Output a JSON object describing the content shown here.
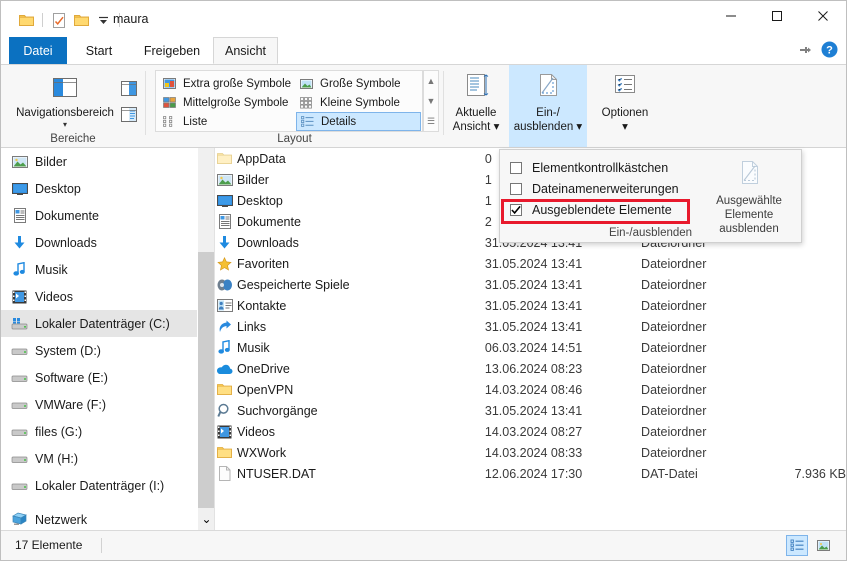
{
  "window": {
    "title": "maura",
    "quick_access": [
      "folder-icon",
      "properties-icon",
      "new-folder-icon",
      "chevron-down-icon"
    ],
    "controls": {
      "minimize": "minimize-icon",
      "maximize": "maximize-icon",
      "close": "close-icon"
    },
    "help": {
      "pin": "pin-ribbon-icon",
      "help": "help-icon"
    }
  },
  "tabs": [
    {
      "label": "Datei",
      "name": "tab-datei"
    },
    {
      "label": "Start",
      "name": "tab-start"
    },
    {
      "label": "Freigeben",
      "name": "tab-freigeben"
    },
    {
      "label": "Ansicht",
      "name": "tab-ansicht"
    }
  ],
  "ribbon": {
    "groups": [
      {
        "label": "Bereiche"
      },
      {
        "label": "Layout"
      }
    ],
    "nav_pane": {
      "label": "Navigationsbereich",
      "caret": "▾"
    },
    "pane_buttons": [
      "preview-pane-icon",
      "details-pane-icon"
    ],
    "layout_items": [
      {
        "label": "Extra große Symbole",
        "icon": "extra-large-icons-icon",
        "selected": false
      },
      {
        "label": "Große Symbole",
        "icon": "large-icons-icon",
        "selected": false
      },
      {
        "label": "Mittelgroße Symbole",
        "icon": "medium-icons-icon",
        "selected": false
      },
      {
        "label": "Kleine Symbole",
        "icon": "small-icons-icon",
        "selected": false
      },
      {
        "label": "Liste",
        "icon": "list-icon",
        "selected": false
      },
      {
        "label": "Details",
        "icon": "details-icon",
        "selected": true
      }
    ],
    "scroll_glyphs": [
      "▲",
      "▼",
      "☰"
    ],
    "buttons": [
      {
        "label_line1": "Aktuelle",
        "label_line2": "Ansicht ▾",
        "icon": "current-view-icon",
        "active": false
      },
      {
        "label_line1": "Ein-/",
        "label_line2": "ausblenden ▾",
        "icon": "show-hide-icon",
        "active": true
      },
      {
        "label_line1": "Optionen",
        "label_line2": "▾",
        "icon": "options-icon",
        "active": false
      }
    ]
  },
  "dropdown": {
    "items": [
      {
        "label": "Elementkontrollkästchen",
        "checked": false
      },
      {
        "label": "Dateinamenerweiterungen",
        "checked": false
      },
      {
        "label": "Ausgeblendete Elemente",
        "checked": true
      }
    ],
    "button": {
      "label_line1": "Ausgewählte",
      "label_line2": "Elemente ausblenden",
      "icon": "hide-selected-icon"
    },
    "group_label": "Ein-/ausblenden",
    "highlight_color": "#e8192c",
    "check_glyph": "✔"
  },
  "nav_tree": {
    "items": [
      {
        "label": "Bilder",
        "icon": "pictures-icon",
        "selected": false
      },
      {
        "label": "Desktop",
        "icon": "desktop-icon",
        "selected": false
      },
      {
        "label": "Dokumente",
        "icon": "documents-icon",
        "selected": false
      },
      {
        "label": "Downloads",
        "icon": "downloads-icon",
        "selected": false
      },
      {
        "label": "Musik",
        "icon": "music-icon",
        "selected": false
      },
      {
        "label": "Videos",
        "icon": "videos-icon",
        "selected": false
      },
      {
        "label": "Lokaler Datenträger (C:)",
        "icon": "drive-icon",
        "selected": true
      },
      {
        "label": "System (D:)",
        "icon": "drive-icon",
        "selected": false
      },
      {
        "label": "Software (E:)",
        "icon": "drive-icon",
        "selected": false
      },
      {
        "label": "VMWare (F:)",
        "icon": "drive-icon",
        "selected": false
      },
      {
        "label": "files (G:)",
        "icon": "drive-icon",
        "selected": false
      },
      {
        "label": "VM (H:)",
        "icon": "drive-icon",
        "selected": false
      },
      {
        "label": "Lokaler Datenträger (I:)",
        "icon": "drive-icon",
        "selected": false
      },
      {
        "label": "Netzwerk",
        "icon": "network-icon",
        "selected": false
      }
    ],
    "scroll_down_glyph": "⌄"
  },
  "file_list": {
    "rows": [
      {
        "name": "AppData",
        "icon": "folder-faded-icon",
        "date": "0",
        "type": "",
        "size": ""
      },
      {
        "name": "Bilder",
        "icon": "pictures-icon",
        "date": "1",
        "type": "",
        "size": ""
      },
      {
        "name": "Desktop",
        "icon": "desktop-icon",
        "date": "1",
        "type": "",
        "size": ""
      },
      {
        "name": "Dokumente",
        "icon": "documents-icon",
        "date": "2",
        "type": "",
        "size": ""
      },
      {
        "name": "Downloads",
        "icon": "downloads-icon",
        "date": "31.05.2024 13:41",
        "type": "Dateiordner",
        "size": ""
      },
      {
        "name": "Favoriten",
        "icon": "favorites-icon",
        "date": "31.05.2024 13:41",
        "type": "Dateiordner",
        "size": ""
      },
      {
        "name": "Gespeicherte Spiele",
        "icon": "saved-games-icon",
        "date": "31.05.2024 13:41",
        "type": "Dateiordner",
        "size": ""
      },
      {
        "name": "Kontakte",
        "icon": "contacts-icon",
        "date": "31.05.2024 13:41",
        "type": "Dateiordner",
        "size": ""
      },
      {
        "name": "Links",
        "icon": "links-icon",
        "date": "31.05.2024 13:41",
        "type": "Dateiordner",
        "size": ""
      },
      {
        "name": "Musik",
        "icon": "music-icon",
        "date": "06.03.2024 14:51",
        "type": "Dateiordner",
        "size": ""
      },
      {
        "name": "OneDrive",
        "icon": "onedrive-icon",
        "date": "13.06.2024 08:23",
        "type": "Dateiordner",
        "size": ""
      },
      {
        "name": "OpenVPN",
        "icon": "folder-icon",
        "date": "14.03.2024 08:46",
        "type": "Dateiordner",
        "size": ""
      },
      {
        "name": "Suchvorgänge",
        "icon": "searches-icon",
        "date": "31.05.2024 13:41",
        "type": "Dateiordner",
        "size": ""
      },
      {
        "name": "Videos",
        "icon": "videos-icon",
        "date": "14.03.2024 08:27",
        "type": "Dateiordner",
        "size": ""
      },
      {
        "name": "WXWork",
        "icon": "folder-icon",
        "date": "14.03.2024 08:33",
        "type": "Dateiordner",
        "size": ""
      },
      {
        "name": "NTUSER.DAT",
        "icon": "file-icon",
        "date": "12.06.2024 17:30",
        "type": "DAT-Datei",
        "size": "7.936 KB"
      }
    ]
  },
  "status_bar": {
    "item_count": "17 Elemente",
    "views": [
      {
        "name": "details-view-button",
        "active": true
      },
      {
        "name": "large-icons-view-button",
        "active": false
      }
    ]
  }
}
